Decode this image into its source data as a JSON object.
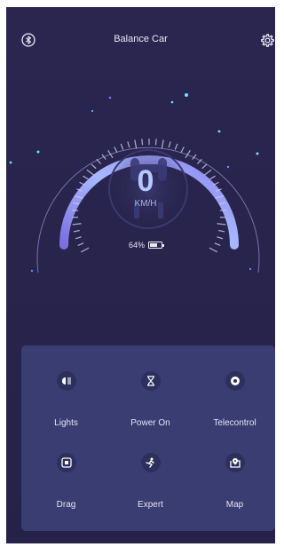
{
  "header": {
    "title": "Balance Car",
    "left_icon": "bluetooth-icon",
    "right_icon": "gear-icon"
  },
  "speedometer": {
    "speed": "0",
    "unit": "KM/H",
    "battery_percent": "64%",
    "battery_level": 0.64,
    "accent_start": "#7a6fe0",
    "accent_end": "#a8b8ff"
  },
  "controls": [
    {
      "label": "Lights",
      "icon": "headlight-icon"
    },
    {
      "label": "Power On",
      "icon": "hourglass-icon"
    },
    {
      "label": "Telecontrol",
      "icon": "remote-icon"
    },
    {
      "label": "Drag",
      "icon": "drag-icon"
    },
    {
      "label": "Expert",
      "icon": "expert-rider-icon"
    },
    {
      "label": "Map",
      "icon": "map-pin-icon"
    }
  ],
  "colors": {
    "background": "#28244c",
    "panel": "#3a3d72",
    "text": "#e9e8f5"
  }
}
